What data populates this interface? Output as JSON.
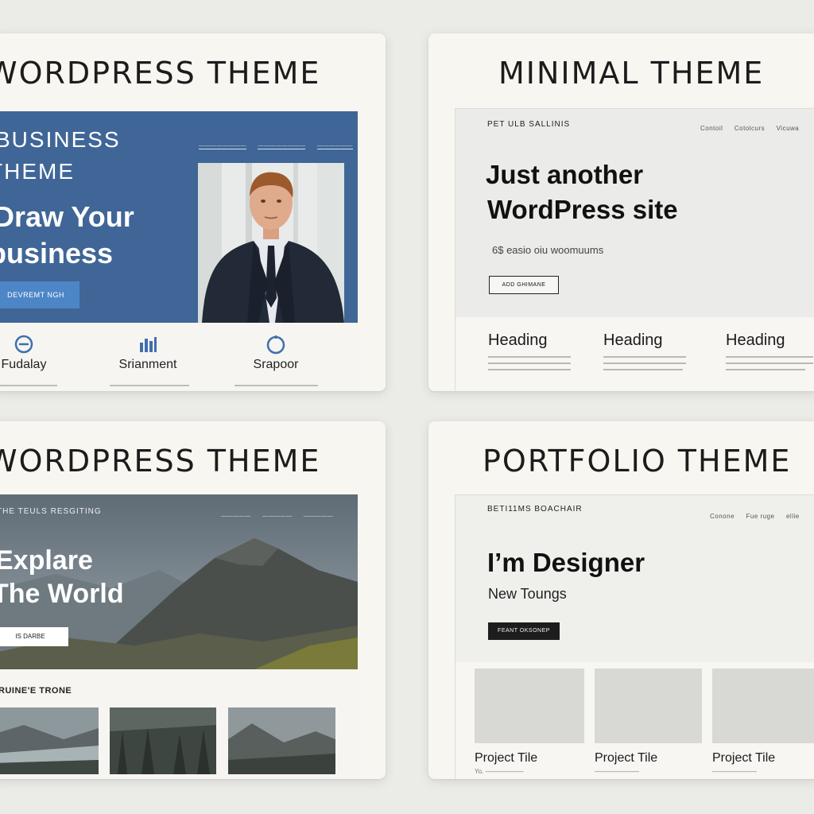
{
  "cards": {
    "business": {
      "title": "WORDPRESS THEME",
      "hero": {
        "tag_line1": "BUSINESS",
        "tag_line2": "THEME",
        "heading_line1": "Draw Your",
        "heading_line2": "business",
        "cta": "DEVREMT NGH",
        "nav": [
          "————————",
          "————————",
          "——————"
        ]
      },
      "features": [
        {
          "icon": "target-icon",
          "label": "Fudalay"
        },
        {
          "icon": "bar-chart-icon",
          "label": "Srianment"
        },
        {
          "icon": "circle-icon",
          "label": "Srapoor"
        }
      ],
      "colors": {
        "hero_bg": "#3f6696",
        "button": "#4d86c7"
      }
    },
    "minimal": {
      "title": "MINIMAL  THEME",
      "site_name": "PET ULB SALLINIS",
      "nav": [
        "Contoil",
        "Cotolcurs",
        "Vicuwa"
      ],
      "heading_line1": "Just another",
      "heading_line2": "WordPress site",
      "tagline": "6$ easio oiu woomuums",
      "button": "ADD GHIMANE",
      "columns": [
        {
          "heading": "Heading"
        },
        {
          "heading": "Heading"
        },
        {
          "heading": "Heading"
        }
      ]
    },
    "explore": {
      "title": "WORDPRESS THEME",
      "site_name": "THE TEULS RESGITING",
      "nav": [
        "—————",
        "—————",
        "—————"
      ],
      "heading_line1": "Explare",
      "heading_line2": "The World",
      "button": "IS DARBE",
      "section_title": "RUINE'E TRONE"
    },
    "portfolio": {
      "title": "PORTFOLIO THEME",
      "site_name": "BETI11MS BOACHAIR",
      "nav": [
        "Conone",
        "Fue ruge",
        "ellie"
      ],
      "heading": "I’m Designer",
      "subheading": "New Toungs",
      "button": "FEANT OKSONEP",
      "projects": [
        {
          "title": "Project Tile",
          "meta": "Yo. ——————"
        },
        {
          "title": "Project Tile",
          "meta": "———————"
        },
        {
          "title": "Project Tile",
          "meta": "———————"
        }
      ]
    }
  }
}
